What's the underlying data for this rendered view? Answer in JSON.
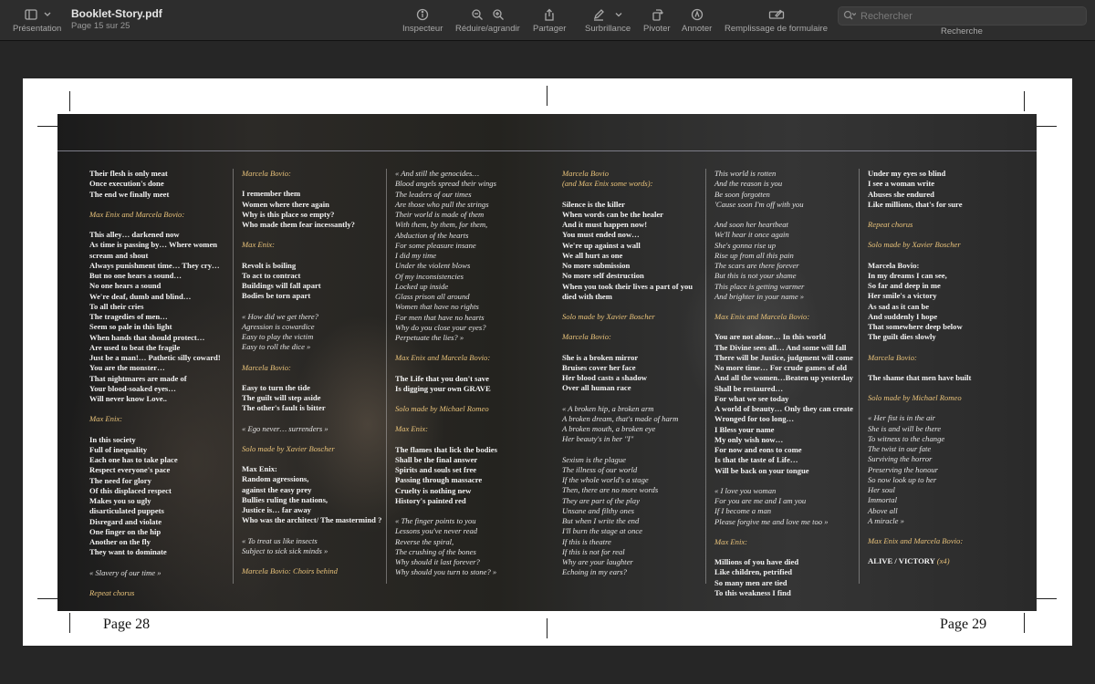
{
  "toolbar": {
    "presentation_label": "Présentation",
    "doc_title": "Booklet-Story.pdf",
    "doc_subtitle": "Page 15 sur 25",
    "inspector_label": "Inspecteur",
    "zoom_label": "Réduire/agrandir",
    "share_label": "Partager",
    "highlight_label": "Surbrillance",
    "rotate_label": "Pivoter",
    "annotate_label": "Annoter",
    "form_label": "Remplissage de formulaire",
    "search_placeholder": "Rechercher",
    "search_label": "Recherche"
  },
  "icons": [
    "sidebar-icon",
    "chevron-down-icon",
    "info-icon",
    "zoom-out-icon",
    "zoom-in-icon",
    "share-icon",
    "pen-icon",
    "rotate-icon",
    "markup-icon",
    "form-fill-icon",
    "search-icon"
  ],
  "colors": {
    "toolbar_bg": "#2d2d2d",
    "desk_bg": "#262626",
    "paper": "#ffffff",
    "credit_gold": "#e8c27a"
  },
  "pages": {
    "left_number": "Page 28",
    "right_number": "Page 29"
  },
  "columns": [
    {
      "blocks": [
        {
          "style": "n",
          "text": "Their flesh is only meat\nOnce execution's done\nThe end we finally meet"
        },
        {
          "style": "c",
          "text": "Max Enix and Marcela Bovio:"
        },
        {
          "style": "n",
          "text": "This alley… darkened now\nAs time is passing by… Where women\nscream and shout\nAlways punishment time… They cry…\nBut no one hears a sound…\nNo one hears a sound\nWe're deaf, dumb and blind…\nTo all their cries\nThe tragedies of men…\nSeem so pale in this light\nWhen hands that should protect…\nAre used to beat the fragile\nJust be a man!… Pathetic silly coward!\nYou are the monster…\nThat nightmares are made of\nYour blood-soaked eyes…\nWill never know Love.."
        },
        {
          "style": "c",
          "text": "Max Enix:"
        },
        {
          "style": "n",
          "text": "In this society\nFull of inequality\nEach one has to take place\nRespect everyone's pace\nThe need for glory\nOf this displaced respect\nMakes you so ugly\ndisarticulated puppets\nDisregard and violate\nOne finger on the hip\nAnother on the fly\nThey want to dominate"
        },
        {
          "style": "i",
          "text": "« Slavery of our time »"
        },
        {
          "style": "c",
          "text": "Repeat chorus"
        }
      ]
    },
    {
      "blocks": [
        {
          "style": "c",
          "text": "Marcela Bovio:"
        },
        {
          "style": "n",
          "text": "I remember them\nWomen where there again\nWhy is this place so empty?\nWho made them fear incessantly?"
        },
        {
          "style": "c",
          "text": "Max Enix:"
        },
        {
          "style": "n",
          "text": "Revolt is boiling\nTo act to contract\nBuildings will fall apart\nBodies be torn apart"
        },
        {
          "style": "i",
          "text": "« How did we get there?\nAgression is cowardice\nEasy to play the victim\nEasy to roll the dice »"
        },
        {
          "style": "c",
          "text": "Marcela Bovio:"
        },
        {
          "style": "n",
          "text": "Easy to turn the tide\nThe guilt will step aside\nThe other's fault is bitter"
        },
        {
          "style": "i",
          "text": "« Ego never… surrenders »"
        },
        {
          "style": "c",
          "text": "Solo made by Xavier Boscher"
        },
        {
          "style": "n",
          "text": "Max Enix:\nRandom agressions,\nagainst the easy prey\nBullies ruling the nations,\nJustice is… far away\nWho was the architect/ The mastermind ?"
        },
        {
          "style": "i",
          "text": "« To treat us like insects\nSubject to sick sick minds »"
        },
        {
          "style": "c",
          "text": "Marcela Bovio: Choirs behind"
        }
      ]
    },
    {
      "blocks": [
        {
          "style": "i",
          "text": "« And still the genocides…\nBlood angels spread their wings\nThe leaders of our times\nAre those who pull the strings\nTheir world is made of them\nWith them, by them, for them,\nAbduction of the hearts\nFor some pleasure insane\nI did my time\nUnder the violent blows\nOf my inconsistencies\nLocked up inside\nGlass prison all around\nWomen that have no rights\nFor men that have no hearts\nWhy do you close your eyes?\nPerpetuate the lies? »"
        },
        {
          "style": "c",
          "text": "Max Enix and Marcela Bovio:"
        },
        {
          "style": "n",
          "text": "The Life that you don't save\nIs digging your own GRAVE"
        },
        {
          "style": "c",
          "text": "Solo made by Michael Romeo"
        },
        {
          "style": "c",
          "text": "Max Enix:"
        },
        {
          "style": "n",
          "text": "The flames that lick the bodies\nShall be the final answer\nSpirits and souls set free\nPassing through massacre\nCruelty is nothing new\nHistory's painted red"
        },
        {
          "style": "i",
          "text": "« The finger points to you\nLessons you've never read\nReverse the spiral,\nThe crushing of the bones\nWhy should it last forever?\nWhy should you turn to stone? »"
        }
      ]
    },
    {
      "blocks": [
        {
          "style": "c",
          "text": "Marcela Bovio\n(and Max Enix some words):"
        },
        {
          "style": "n",
          "text": "Silence is the killer\nWhen words can be the healer\nAnd it must happen now!\nYou must ended now…\nWe're up against a wall\nWe all hurt as one\nNo more submission\nNo more self destruction\nWhen you took their lives a part of you\ndied with them"
        },
        {
          "style": "c",
          "text": "Solo made by Xavier Boscher"
        },
        {
          "style": "c",
          "text": "Marcela Bovio:"
        },
        {
          "style": "n",
          "text": "She is a broken mirror\nBruises cover her face\nHer blood casts a shadow\nOver all human race"
        },
        {
          "style": "i",
          "text": "« A broken hip, a broken arm\nA broken dream, that's made of harm\nA broken mouth, a broken eye\nHer beauty's in her \"I\""
        },
        {
          "style": "i",
          "text": "Sexism is the plague\nThe illness of our world\nIf the whole world's a stage\nThen, there are no more words\nThey are part of the play\nUnsane and filthy ones\nBut when I write the end\nI'll burn the stage at once\nIf this is theatre\nIf this is not for real\nWhy are your laughter\nEchoing in my ears?"
        }
      ]
    },
    {
      "blocks": [
        {
          "style": "i",
          "text": "This world is rotten\nAnd the reason is you\nBe soon forgotten\n'Cause soon I'm off with you"
        },
        {
          "style": "i",
          "text": "And soon her heartbeat\nWe'll hear it once again\nShe's gonna rise up\nRise up from all this pain\nThe scars are there forever\nBut this is not your shame\nThis place is getting warmer\nAnd brighter in your name »"
        },
        {
          "style": "c",
          "text": "Max Enix and Marcela Bovio:"
        },
        {
          "style": "n",
          "text": "You are not alone… In this world\nThe Divine sees all… And some will fall\nThere will be Justice, judgment will come\nNo more time… For crude games of old\nAnd all the women…Beaten up yesterday\nShall be restaured…\nFor what we see today\nA world of beauty… Only they can create\nWronged for too long…\nI Bless your name\nMy only wish now…\nFor now and eons to come\nIs that the taste of Life…\nWill be back on your tongue"
        },
        {
          "style": "i",
          "text": "« I love you woman\nFor you are me and I am you\nIf I become a man\nPlease forgive me and love me too »"
        },
        {
          "style": "c",
          "text": "Max Enix:"
        },
        {
          "style": "n",
          "text": "Millions of you have died\nLike children, petrified\nSo many men are tied\nTo this weakness I find"
        }
      ]
    },
    {
      "blocks": [
        {
          "style": "n",
          "text": "Under my eyes so blind\nI see a woman write\nAbuses she endured\nLike millions, that's for sure"
        },
        {
          "style": "c",
          "text": "Repeat chorus"
        },
        {
          "style": "c",
          "text": "Solo made by Xavier Boscher"
        },
        {
          "style": "n",
          "text": "Marcela Bovio:\nIn my dreams I can see,\nSo far and deep in me\nHer smile's a victory\nAs sad as it can be\nAnd suddenly I hope\nThat somewhere deep below\nThe guilt dies slowly"
        },
        {
          "style": "c",
          "text": "Marcela Bovio:"
        },
        {
          "style": "n",
          "text": "The shame that men have built"
        },
        {
          "style": "c",
          "text": "Solo made by Michael Romeo"
        },
        {
          "style": "i",
          "text": "« Her fist is in the air\nShe is and will be there\nTo witness to the change\nThe twist in our fate\nSurviving the horror\nPreserving the honour\nSo now look up to her\nHer soul\nImmortal\nAbove all\nA miracle »"
        },
        {
          "style": "c",
          "text": "Max Enix and Marcela Bovio:"
        },
        {
          "style": "n",
          "text": "ALIVE / VICTORY "
        },
        {
          "style": "c",
          "text": "(x4)"
        }
      ]
    }
  ]
}
